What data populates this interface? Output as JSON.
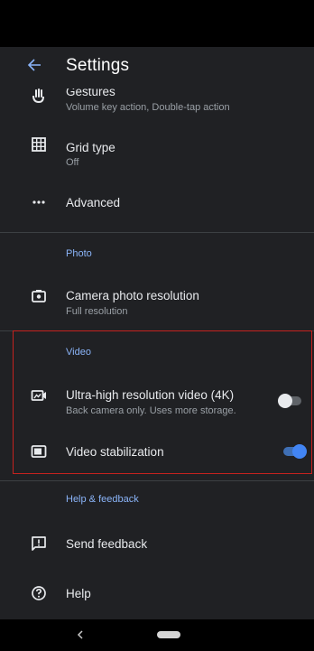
{
  "app_bar": {
    "title": "Settings",
    "back_icon": "arrow-back-icon"
  },
  "items": {
    "gestures": {
      "label": "Gestures",
      "sub": "Volume key action, Double-tap action",
      "icon": "gesture-hand-icon"
    },
    "grid": {
      "label": "Grid type",
      "sub": "Off",
      "icon": "grid-icon"
    },
    "advanced": {
      "label": "Advanced",
      "icon": "more-horiz-icon"
    },
    "photo_res": {
      "label": "Camera photo resolution",
      "sub": "Full resolution",
      "icon": "camera-icon"
    },
    "uhd_video": {
      "label": "Ultra-high resolution video (4K)",
      "sub": "Back camera only. Uses more storage.",
      "icon": "video-hd-icon",
      "toggle": "off"
    },
    "stabilization": {
      "label": "Video stabilization",
      "icon": "video-stabilization-icon",
      "toggle": "on"
    },
    "feedback": {
      "label": "Send feedback",
      "icon": "feedback-icon"
    },
    "help": {
      "label": "Help",
      "icon": "help-icon"
    }
  },
  "sections": {
    "photo": "Photo",
    "video": "Video",
    "help_feedback": "Help & feedback"
  },
  "colors": {
    "accent": "#8ab4f8",
    "toggle_on": "#4285f4",
    "highlight_border": "#c5221f",
    "background": "#202124"
  },
  "nav": {
    "back_icon": "nav-back-icon",
    "home_icon": "nav-home-pill-icon"
  }
}
